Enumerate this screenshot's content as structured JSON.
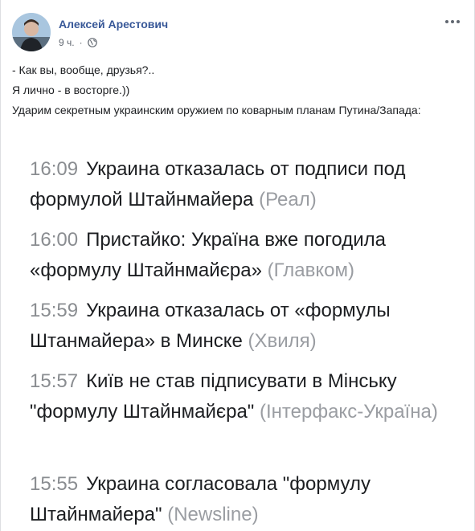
{
  "post": {
    "author": "Алексей Арестович",
    "time_ago": "9 ч.",
    "separator": "·",
    "icons": {
      "privacy": "globe-icon",
      "menu": "more-dots-icon",
      "avatar": "profile-avatar"
    },
    "lines": [
      "- Как вы, вообще, друзья?..",
      "Я лично - в восторге.))",
      "Ударим секретным украинским оружием по коварным планам Путина/Запада:"
    ]
  },
  "news": [
    {
      "time": "16:09",
      "headline": "Украина отказалась от подписи под формулой Штайнмайера",
      "source": "(Реал)"
    },
    {
      "time": "16:00",
      "headline": "Пристайко: Україна вже погодила «формулу Штайнмайєра»",
      "source": "(Главком)"
    },
    {
      "time": "15:59",
      "headline": "Украина отказалась от «формулы Штанмайера» в Минске",
      "source": "(Хвиля)"
    },
    {
      "time": "15:57",
      "headline": "Київ не став підписувати в Мінську \"формулу Штайнмайєра\"",
      "source": "(Інтерфакс-Україна)"
    },
    {
      "time": "15:55",
      "headline": "Украина согласовала \"формулу Штайнмайера\"",
      "source": "(Newsline)"
    }
  ],
  "colors": {
    "author": "#385898",
    "meta": "#616770",
    "text": "#1c1e21",
    "news_time": "#8a8d91",
    "news_source": "#9a9da2"
  }
}
